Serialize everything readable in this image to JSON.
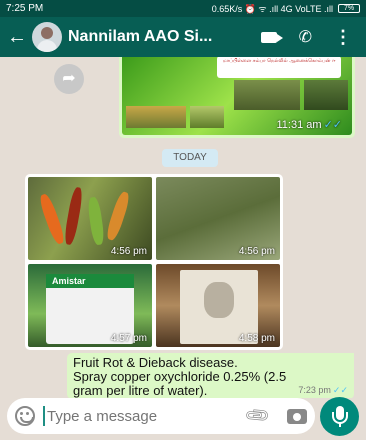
{
  "status_bar": {
    "time": "7:25 PM",
    "right_text": "0.65K/s ⏰ ᯤ .ıll 4G VoLTE .ıll",
    "battery": "7%"
  },
  "header": {
    "title": "Nannilam AAO Si...",
    "icons": [
      "back-arrow-icon",
      "avatar",
      "video-call-icon",
      "phone-icon",
      "more-options-icon"
    ]
  },
  "messages": {
    "forwarded_image": {
      "time": "11:31 am",
      "poster_text": "மாப்பிள்ளை சம்பா நெல்லில் ஆனைக்கொம்பன் ஈ",
      "status": "read"
    },
    "date_divider": "TODAY",
    "gallery": {
      "images": [
        {
          "subject": "infected chilli fruits",
          "time": "4:56 pm"
        },
        {
          "subject": "dried chilli plants",
          "time": "4:56 pm"
        },
        {
          "subject": "Amistar",
          "time": "4:57 pm"
        },
        {
          "subject": "fungicide sachet",
          "time": "4:58 pm"
        }
      ]
    },
    "text_message": {
      "lines": [
        "Fruit Rot & Dieback disease.",
        "Spray copper oxychloride 0.25% (2.5",
        "gram per litre of water)."
      ],
      "time": "7:23 pm",
      "status": "read"
    }
  },
  "composer": {
    "placeholder": "Type a message",
    "icons": [
      "emoji-icon",
      "attach-icon",
      "camera-icon",
      "mic-icon"
    ]
  },
  "colors": {
    "header": "#075e54",
    "statusbar": "#054d44",
    "outgoing_bubble": "#dcf8c6",
    "chat_background": "#e5ddd5",
    "accent": "#00897b"
  }
}
